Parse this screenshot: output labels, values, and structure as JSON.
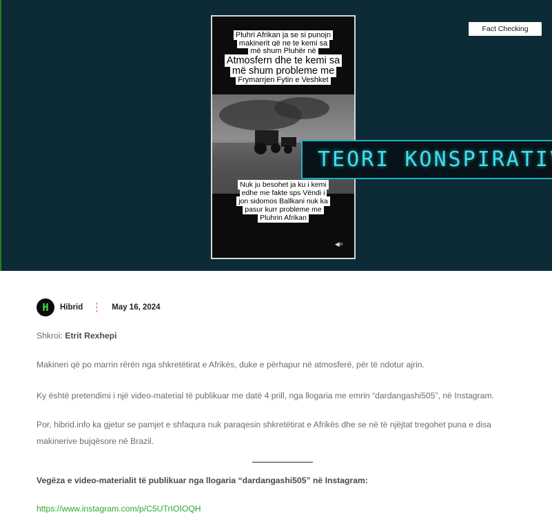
{
  "hero": {
    "badge": "Fact Checking",
    "caption_top_lines": [
      "Pluhri Afrikan ja se si punojn",
      "makinerit që ne te kemi sa",
      "më shum Pluhër në"
    ],
    "caption_big_lines": [
      "Atmosfern dhe te kemi sa",
      "më shum probleme me"
    ],
    "caption_top_last": "Frymarrjen Fytin e Veshket",
    "caption_bottom_lines": [
      "Nuk ju besohet ja ku i kemi",
      "edhe me fakte sps Vëndi i",
      "jon sidomos Ballkani nuk ka",
      "pasur kurr probleme me",
      "Pluhrin Afrikan"
    ],
    "banner": "TEORI KONSPIRATIVE"
  },
  "meta": {
    "avatar_letter": "H",
    "author": "Hibrid",
    "date": "May 16, 2024"
  },
  "article": {
    "byline_label": "Shkroi:",
    "byline_name": "Etrit Rexhepi",
    "p1": "Makineri që po marrin rërën nga shkretëtirat e Afrikës, duke e përhapur në atmosferë, për të ndotur ajrin.",
    "p2": "Ky është pretendimi i një video-material të publikuar me datë 4 prill, nga llogaria me emrin “dardangashi505”, në Instagram.",
    "p3": "Por, hibrid.info ka gjetur se pamjet e shfaqura nuk paraqesin shkretëtirat e Afrikës dhe se në të njëjtat tregohet puna e disa makinerive bujqësore në Brazil.",
    "link_heading": "Vegëza e video-materialit të publikuar nga llogaria “dardangashi505” në Instagram:",
    "link_url": "https://www.instagram.com/p/C5UTrIOIOQH"
  },
  "colors": {
    "hero_bg": "#0d2b36",
    "banner_accent": "#3fe0ee",
    "link": "#2aaa2a",
    "separator": "#e34b4b"
  }
}
